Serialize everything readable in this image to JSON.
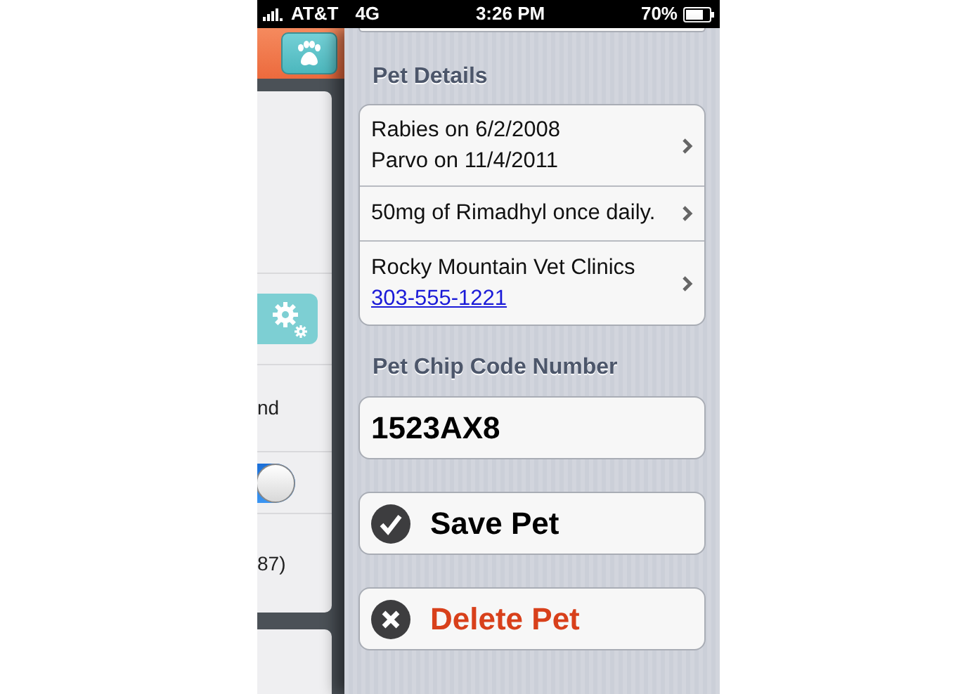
{
  "status_bar": {
    "carrier": "AT&T",
    "network": "4G",
    "time": "3:26 PM",
    "battery": "70%"
  },
  "side_menu": {
    "items": [
      {
        "kind": "blank"
      },
      {
        "kind": "gear-button"
      },
      {
        "kind": "text",
        "label": "nd"
      },
      {
        "kind": "toggle",
        "on": true
      },
      {
        "kind": "text",
        "label": "87)"
      }
    ]
  },
  "pet_details": {
    "heading": "Pet Details",
    "rows": [
      {
        "lines": [
          "Rabies on 6/2/2008",
          "Parvo on 11/4/2011"
        ]
      },
      {
        "lines": [
          "50mg of Rimadhyl once daily."
        ]
      },
      {
        "lines": [
          "Rocky Mountain Vet Clinics"
        ],
        "link": "303-555-1221"
      }
    ]
  },
  "chip": {
    "heading": "Pet Chip Code Number",
    "value": "1523AX8"
  },
  "buttons": [
    {
      "kind": "save",
      "label": "Save Pet"
    },
    {
      "kind": "delete",
      "label": "Delete Pet"
    }
  ]
}
